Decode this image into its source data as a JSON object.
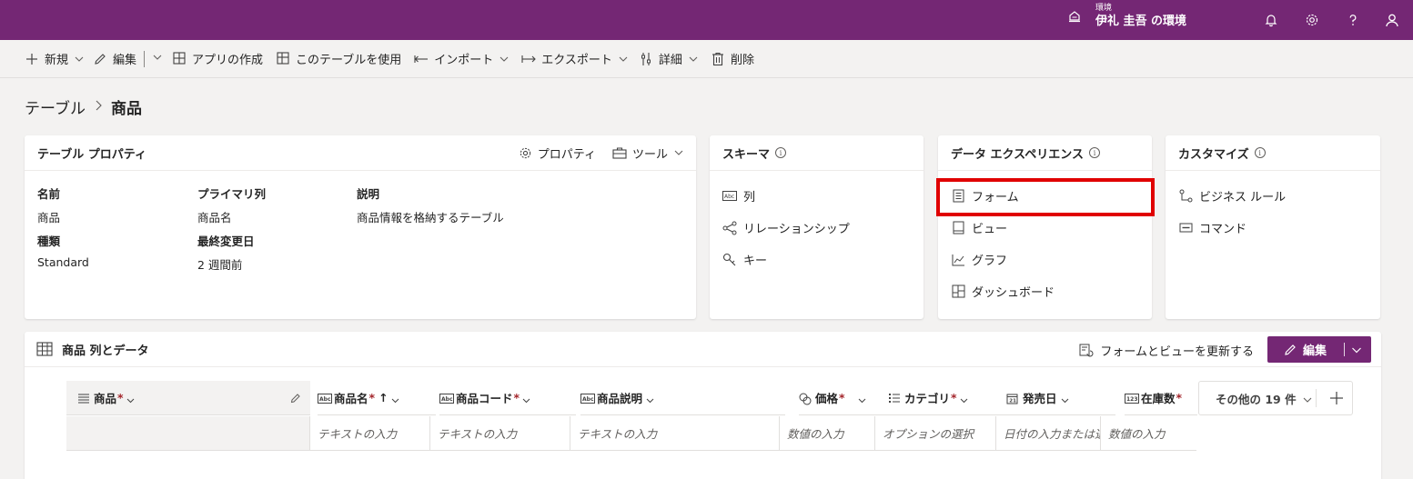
{
  "topbar": {
    "env_label": "環境",
    "env_name": "伊礼 圭吾 の環境",
    "brand_color": "#742774"
  },
  "commands": {
    "new": "新規",
    "edit": "編集",
    "create_app": "アプリの作成",
    "use_table": "このテーブルを使用",
    "import": "インポート",
    "export": "エクスポート",
    "details": "詳細",
    "delete": "削除"
  },
  "breadcrumb": {
    "parent": "テーブル",
    "current": "商品"
  },
  "properties": {
    "title": "テーブル プロパティ",
    "props_btn": "プロパティ",
    "tools_btn": "ツール",
    "name_label": "名前",
    "name_value": "商品",
    "primary_label": "プライマリ列",
    "primary_value": "商品名",
    "desc_label": "説明",
    "desc_value": "商品情報を格納するテーブル",
    "type_label": "種類",
    "type_value": "Standard",
    "modified_label": "最終変更日",
    "modified_value": "2 週間前"
  },
  "schema": {
    "title": "スキーマ",
    "items": [
      "列",
      "リレーションシップ",
      "キー"
    ]
  },
  "experience": {
    "title": "データ エクスペリエンス",
    "items": [
      "フォーム",
      "ビュー",
      "グラフ",
      "ダッシュボード"
    ]
  },
  "customize": {
    "title": "カスタマイズ",
    "items": [
      "ビジネス ルール",
      "コマンド"
    ]
  },
  "datapanel": {
    "title": "商品 列とデータ",
    "refresh": "フォームとビューを更新する",
    "edit": "編集",
    "more": "その他の 19 件",
    "columns": [
      {
        "label": "商品",
        "required": "*"
      },
      {
        "label": "商品名",
        "required": "*",
        "sort": "↑"
      },
      {
        "label": "商品コード",
        "required": "*"
      },
      {
        "label": "商品説明",
        "required": ""
      },
      {
        "label": "価格",
        "required": "*"
      },
      {
        "label": "カテゴリ",
        "required": "*"
      },
      {
        "label": "発売日",
        "required": ""
      },
      {
        "label": "在庫数",
        "required": "*"
      }
    ],
    "placeholders": [
      "テキストの入力",
      "テキストの入力",
      "テキストの入力",
      "数値の入力",
      "オプションの選択",
      "日付の入力または選",
      "数値の入力"
    ]
  }
}
